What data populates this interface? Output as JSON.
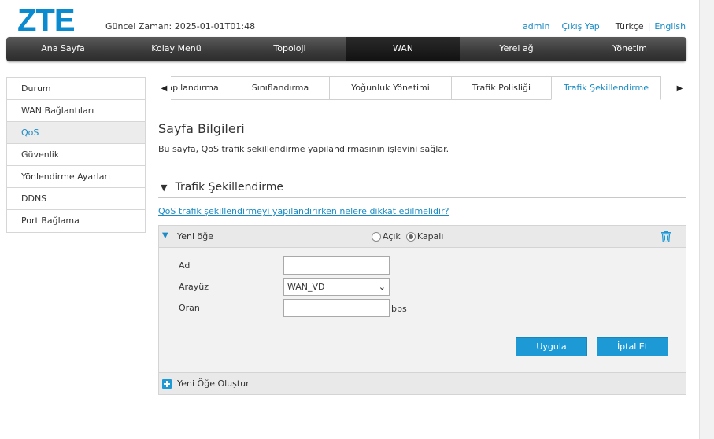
{
  "brand": {
    "logo_text": "ZTE",
    "accent": "#0a8bd0"
  },
  "header": {
    "current_time": "Güncel Zaman: 2025-01-01T01:48",
    "user": "admin",
    "logout": "Çıkış Yap",
    "lang_current": "Türkçe",
    "lang_separator": "|",
    "lang_other": "English"
  },
  "top_nav": {
    "items": [
      "Ana Sayfa",
      "Kolay Menü",
      "Topoloji",
      "WAN",
      "Yerel ağ",
      "Yönetim"
    ],
    "active": "WAN"
  },
  "sidebar": {
    "items": [
      "Durum",
      "WAN Bağlantıları",
      "QoS",
      "Güvenlik",
      "Yönlendirme Ayarları",
      "DDNS",
      "Port Bağlama"
    ],
    "active": "QoS"
  },
  "tabs": {
    "items": [
      "QoS Yapılandırma",
      "Sınıflandırma",
      "Yoğunluk Yönetimi",
      "Trafik Polisliği",
      "Trafik Şekillendirme"
    ],
    "active": "Trafik Şekillendirme",
    "left_arrow_icon": "triangle-left-icon",
    "right_arrow_icon": "triangle-right-icon"
  },
  "page": {
    "title": "Sayfa Bilgileri",
    "description": "Bu sayfa, QoS trafik şekillendirme yapılandırmasının işlevini sağlar.",
    "section_title": "Trafik Şekillendirme",
    "help_link": "QoS trafik şekillendirmeyi yapılandırırken nelere dikkat edilmelidir?"
  },
  "rule": {
    "name": "Yeni öğe",
    "radio_on": "Açık",
    "radio_off": "Kapalı",
    "selected": "Kapalı",
    "fields": {
      "name_label": "Ad",
      "name_value": "",
      "interface_label": "Arayüz",
      "interface_value": "WAN_VD",
      "rate_label": "Oran",
      "rate_value": "",
      "rate_unit": "bps"
    },
    "apply_button": "Uygula",
    "cancel_button": "İptal Et",
    "create_new": "Yeni Öğe Oluştur"
  },
  "colors": {
    "button_blue": "#1d9ad6",
    "link_blue": "#1a8bc4",
    "nav_dark": "#2c2c2c"
  }
}
